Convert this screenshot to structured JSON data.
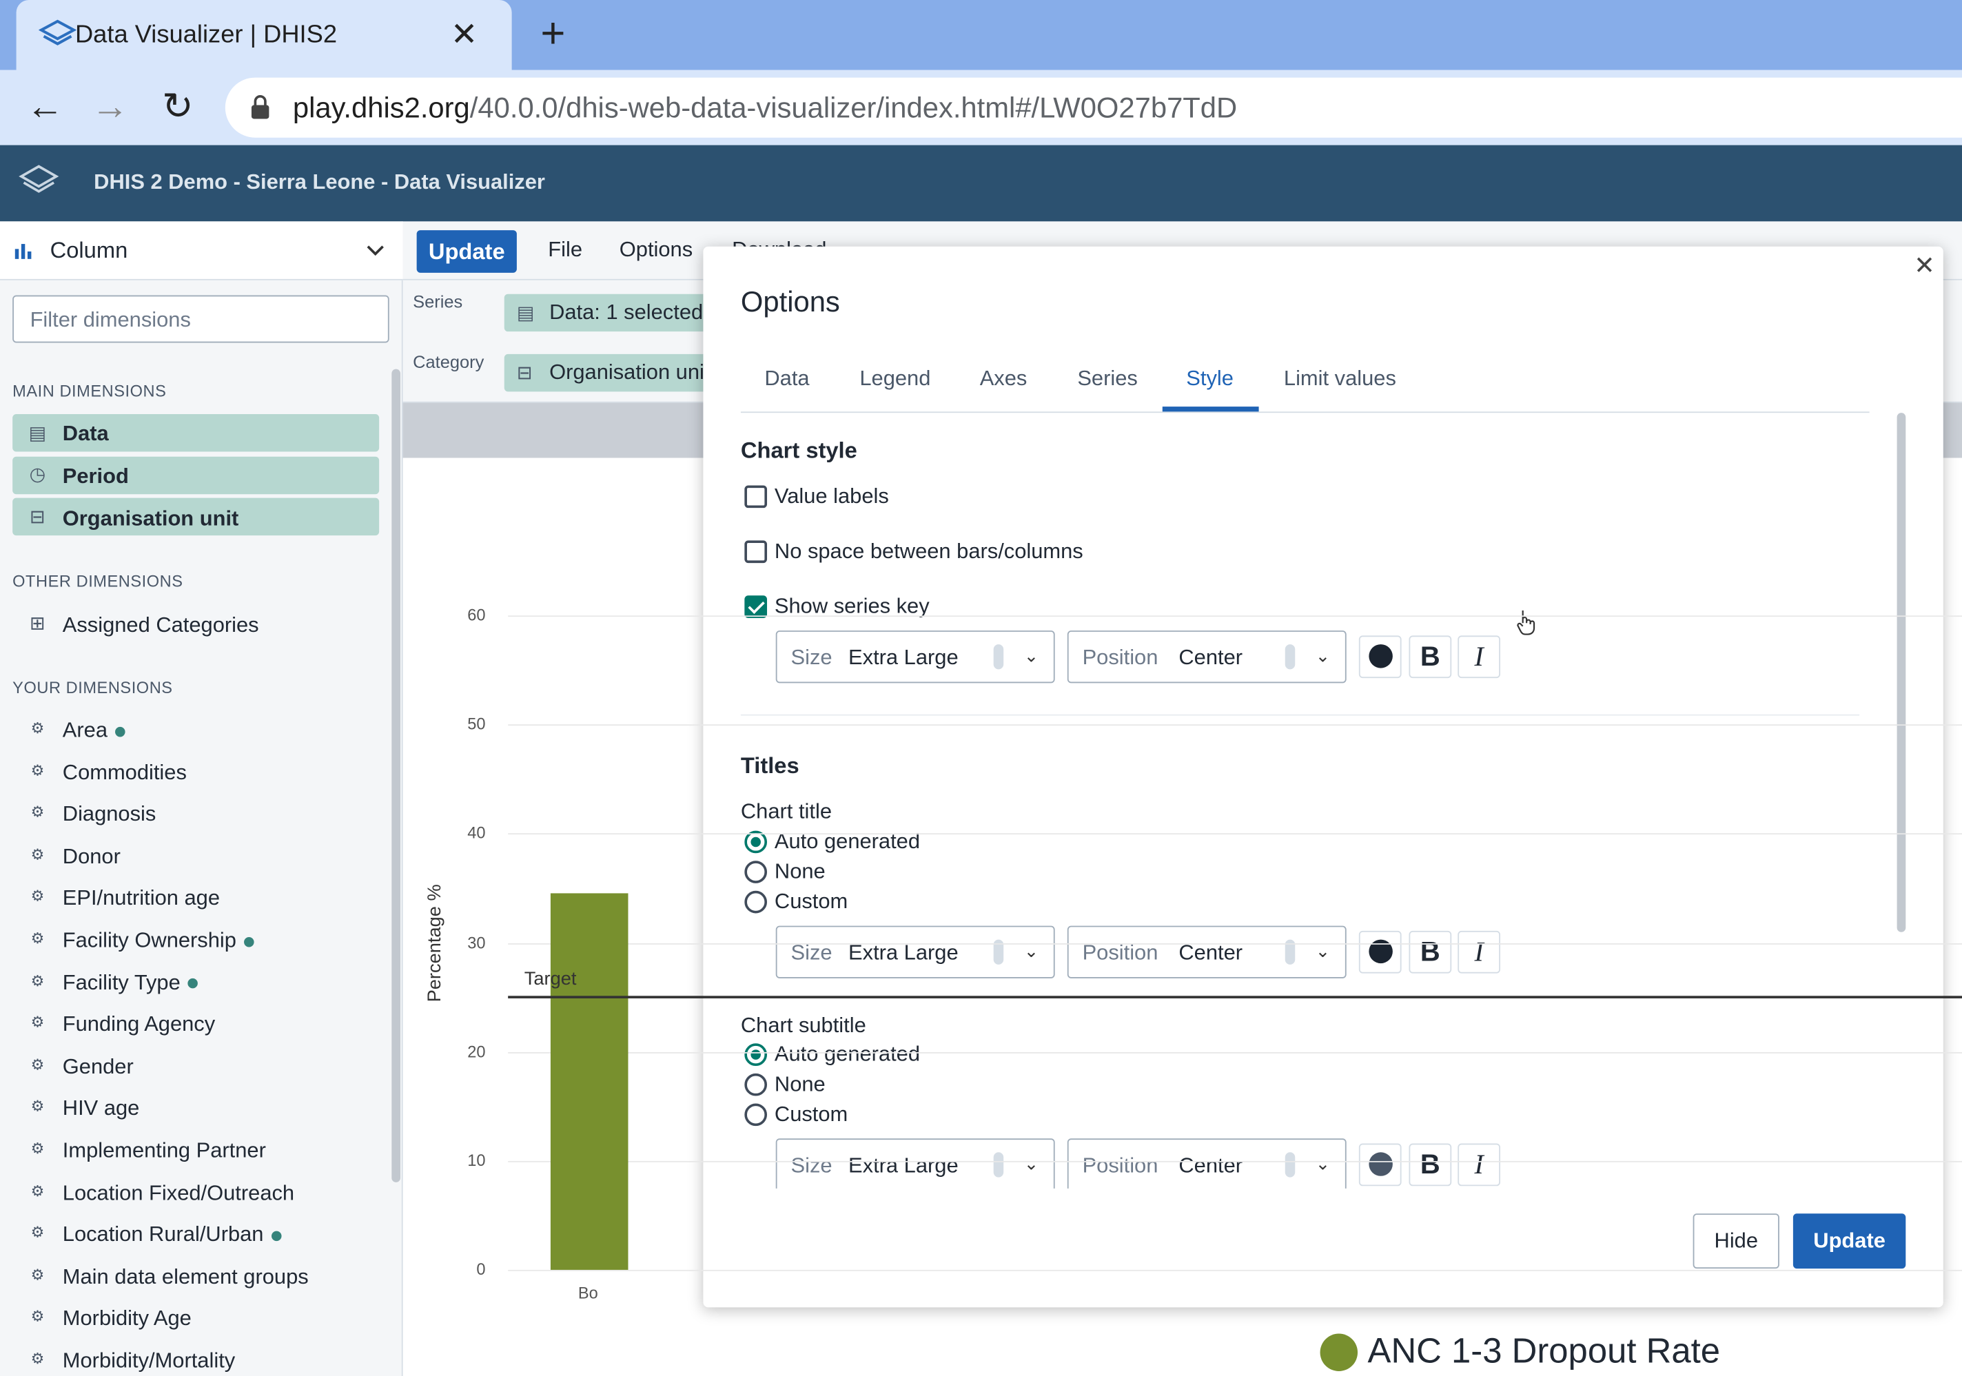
{
  "browser": {
    "tab_title": "Data Visualizer | DHIS2",
    "url_host": "play.dhis2.org",
    "url_path": "/40.0.0/dhis-web-data-visualizer/index.html#/LW0O27b7TdD"
  },
  "header": {
    "title": "DHIS 2 Demo - Sierra Leone - Data Visualizer"
  },
  "sidebar": {
    "vis_type": "Column",
    "filter_placeholder": "Filter dimensions",
    "main_heading": "MAIN DIMENSIONS",
    "main_items": [
      "Data",
      "Period",
      "Organisation unit"
    ],
    "other_heading": "OTHER DIMENSIONS",
    "other_items": [
      "Assigned Categories"
    ],
    "your_heading": "YOUR DIMENSIONS",
    "your_items": [
      {
        "label": "Area",
        "active": true
      },
      {
        "label": "Commodities",
        "active": false
      },
      {
        "label": "Diagnosis",
        "active": false
      },
      {
        "label": "Donor",
        "active": false
      },
      {
        "label": "EPI/nutrition age",
        "active": false
      },
      {
        "label": "Facility Ownership",
        "active": true
      },
      {
        "label": "Facility Type",
        "active": true
      },
      {
        "label": "Funding Agency",
        "active": false
      },
      {
        "label": "Gender",
        "active": false
      },
      {
        "label": "HIV age",
        "active": false
      },
      {
        "label": "Implementing Partner",
        "active": false
      },
      {
        "label": "Location Fixed/Outreach",
        "active": false
      },
      {
        "label": "Location Rural/Urban",
        "active": true
      },
      {
        "label": "Main data element groups",
        "active": false
      },
      {
        "label": "Morbidity Age",
        "active": false
      },
      {
        "label": "Morbidity/Mortality",
        "active": false
      }
    ]
  },
  "toolbar": {
    "update": "Update",
    "file": "File",
    "options": "Options",
    "download": "Download"
  },
  "layout": {
    "series_label": "Series",
    "series_chip": "Data: 1 selected",
    "category_label": "Category",
    "category_chip": "Organisation unit"
  },
  "chart_data": {
    "type": "bar",
    "categories": [
      "Bo"
    ],
    "series": [
      {
        "name": "ANC 1-3 Dropout Rate",
        "values": [
          34.5
        ],
        "color": "#78902e"
      }
    ],
    "ylabel": "Percentage %",
    "yticks": [
      "0",
      "10",
      "20",
      "30",
      "40",
      "50",
      "60"
    ],
    "ylim": [
      0,
      60
    ],
    "target_line": {
      "label": "Target",
      "value": 25
    }
  },
  "modal": {
    "title": "Options",
    "tabs": [
      "Data",
      "Legend",
      "Axes",
      "Series",
      "Style",
      "Limit values"
    ],
    "active_tab": "Style",
    "chart_style_heading": "Chart style",
    "value_labels": {
      "label": "Value labels",
      "checked": false
    },
    "no_space": {
      "label": "No space between bars/columns",
      "checked": false
    },
    "series_key": {
      "label": "Show series key",
      "checked": true
    },
    "size_label": "Size",
    "position_label": "Position",
    "size_value": "Extra Large",
    "position_value": "Center",
    "titles_heading": "Titles",
    "chart_title_label": "Chart title",
    "chart_subtitle_label": "Chart subtitle",
    "radio_options": [
      "Auto generated",
      "None",
      "Custom"
    ],
    "text_color": "#1b2430",
    "hide": "Hide",
    "update": "Update"
  }
}
